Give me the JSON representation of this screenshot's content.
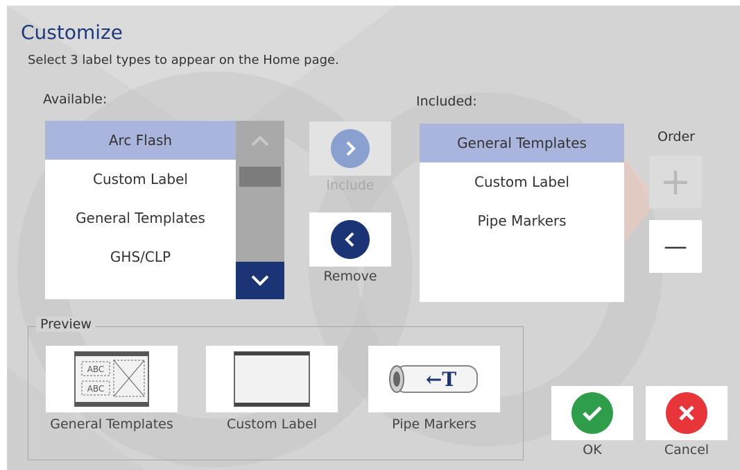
{
  "dialog": {
    "title": "Customize",
    "subtitle": "Select 3 label types to appear on the Home page."
  },
  "available": {
    "label": "Available:",
    "items": [
      "Arc Flash",
      "Custom Label",
      "General Templates",
      "GHS/CLP"
    ],
    "selected_index": 0
  },
  "included": {
    "label": "Included:",
    "items": [
      "General Templates",
      "Custom Label",
      "Pipe Markers"
    ],
    "selected_index": 0
  },
  "transfer": {
    "include_label": "Include",
    "remove_label": "Remove"
  },
  "order": {
    "label": "Order",
    "plus_symbol": "+",
    "minus_symbol": "—"
  },
  "preview": {
    "legend": "Preview",
    "items": [
      {
        "caption": "General Templates",
        "icon": "general-templates-thumb",
        "text_a": "ABC",
        "text_b": "ABC"
      },
      {
        "caption": "Custom Label",
        "icon": "custom-label-thumb"
      },
      {
        "caption": "Pipe Markers",
        "icon": "pipe-marker-thumb",
        "arrow_text": "←T"
      }
    ]
  },
  "actions": {
    "ok_label": "OK",
    "cancel_label": "Cancel"
  },
  "colors": {
    "accent_navy": "#1a3475",
    "selection": "#aab5dd",
    "ok_green": "#2e9e4a",
    "cancel_red": "#e8353a"
  }
}
